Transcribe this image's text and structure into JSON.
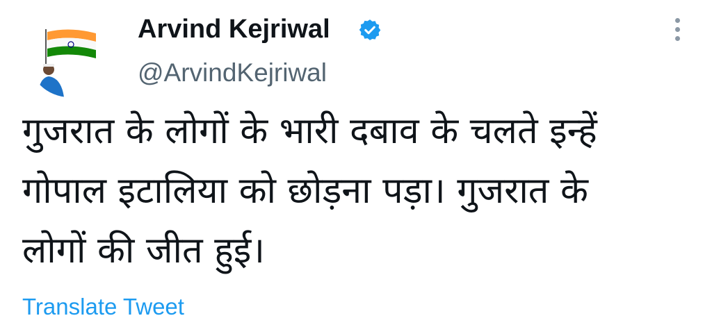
{
  "author": {
    "display_name": "Arvind Kejriwal",
    "handle": "@ArvindKejriwal",
    "verified": true,
    "avatar_icon": "profile-photo-with-indian-flag"
  },
  "tweet": {
    "lines": [
      "गुजरात के लोगों के भारी दबाव के चलते इन्हें",
      "गोपाल इटालिया को छोड़ना पड़ा। गुजरात के",
      "लोगों की जीत हुई।"
    ]
  },
  "actions": {
    "translate_label": "Translate Tweet",
    "more_icon": "vertical-ellipsis-icon"
  },
  "colors": {
    "text": "#0f1419",
    "secondary": "#536471",
    "link": "#1d9bf0",
    "verified_badge": "#1d9bf0",
    "flag_saffron": "#ff9933",
    "flag_green": "#138808",
    "flag_chakra": "#000080"
  }
}
